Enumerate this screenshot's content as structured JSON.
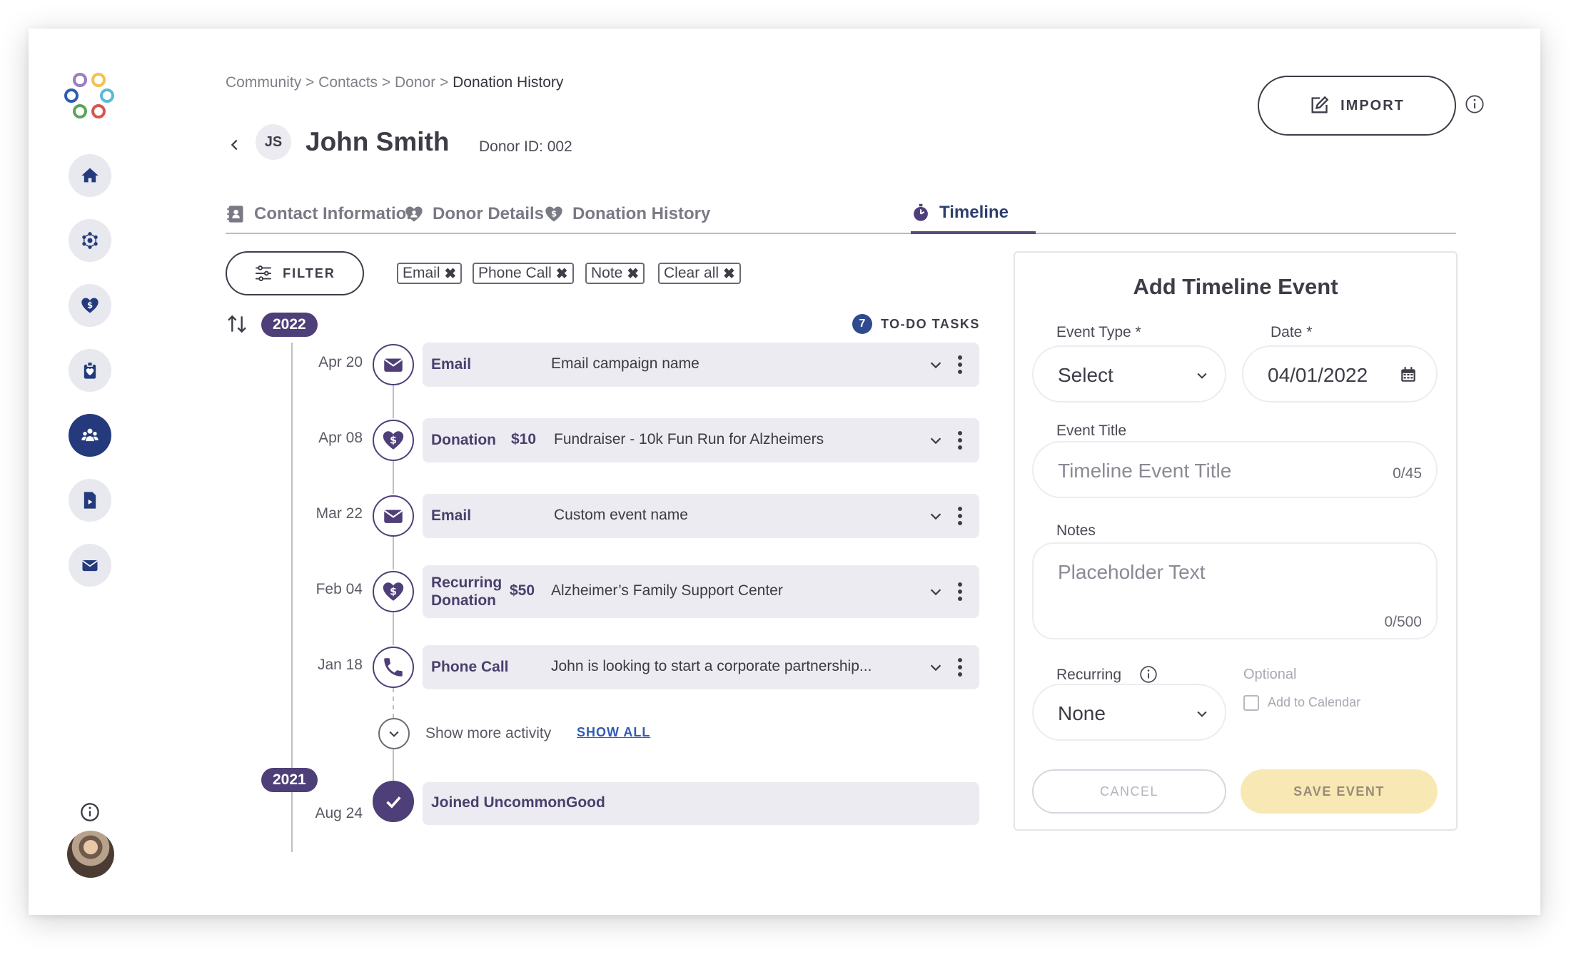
{
  "breadcrumb": {
    "items": [
      "Community",
      "Contacts",
      "Donor"
    ],
    "separator": ">",
    "current": "Donation History"
  },
  "donor": {
    "initials": "JS",
    "name": "John Smith",
    "donor_id": "Donor ID: 002"
  },
  "header": {
    "import_label": "IMPORT"
  },
  "tabs": [
    {
      "label": "Contact Information",
      "icon": "contact-book-icon",
      "active": false
    },
    {
      "label": "Donor Details",
      "icon": "heart-hands-icon",
      "active": false
    },
    {
      "label": "Donation History",
      "icon": "heart-dollar-icon",
      "active": false
    },
    {
      "label": "Timeline",
      "icon": "stopwatch-icon",
      "active": true
    }
  ],
  "filter": {
    "button_label": "FILTER",
    "chips": [
      "Email",
      "Phone Call",
      "Note",
      "Clear all"
    ]
  },
  "todo": {
    "count": "7",
    "label": "TO-DO TASKS"
  },
  "timeline": {
    "year_2022": "2022",
    "year_2021": "2021",
    "events": [
      {
        "date": "Apr 20",
        "type": "Email",
        "amount": "",
        "description": "Email campaign name",
        "icon": "envelope-icon"
      },
      {
        "date": "Apr 08",
        "type": "Donation",
        "amount": "$10",
        "description": "Fundraiser - 10k Fun Run for Alzheimers",
        "icon": "heart-dollar-icon"
      },
      {
        "date": "Mar 22",
        "type": "Email",
        "amount": "",
        "description": "Custom event name",
        "icon": "envelope-icon"
      },
      {
        "date": "Feb 04",
        "type_line1": "Recurring",
        "type_line2": "Donation",
        "amount": "$50",
        "description": "Alzheimer’s Family Support Center",
        "icon": "heart-dollar-icon"
      },
      {
        "date": "Jan 18",
        "type": "Phone Call",
        "amount": "",
        "description": "John is looking to start a corporate partnership...",
        "icon": "phone-icon"
      }
    ],
    "show_more": "Show more activity",
    "show_all": "SHOW ALL",
    "joined": {
      "date": "Aug 24",
      "label": "Joined UncommonGood",
      "icon": "check-icon"
    }
  },
  "panel": {
    "title": "Add Timeline Event",
    "event_type_label": "Event Type *",
    "event_type_value": "Select",
    "date_label": "Date *",
    "date_value": "04/01/2022",
    "event_title_label": "Event Title",
    "event_title_placeholder": "Timeline Event Title",
    "event_title_count": "0/45",
    "notes_label": "Notes",
    "notes_placeholder": "Placeholder Text",
    "notes_count": "0/500",
    "recurring_label": "Recurring",
    "recurring_value": "None",
    "optional_label": "Optional",
    "add_to_calendar_label": "Add to Calendar",
    "cancel_label": "CANCEL",
    "save_label": "SAVE EVENT"
  },
  "colors": {
    "primary_purple": "#4f3f78",
    "nav_active": "#243a7c",
    "link_blue": "#2f5bb6",
    "save_bg": "#f8e9b4",
    "card_bg": "#ecebf2"
  }
}
